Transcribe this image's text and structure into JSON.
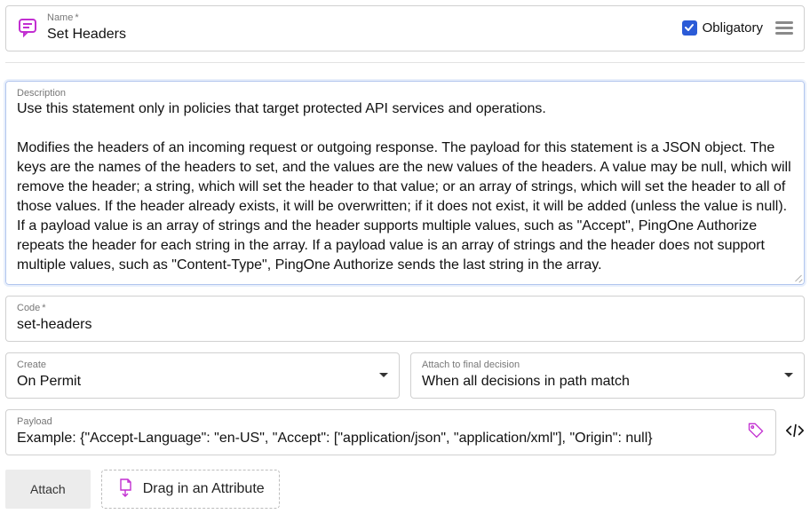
{
  "name": {
    "label": "Name",
    "required_marker": "*",
    "value": "Set Headers"
  },
  "obligatory": {
    "label": "Obligatory",
    "checked": true
  },
  "description": {
    "label": "Description",
    "value": "Use this statement only in policies that target protected API services and operations.\n\nModifies the headers of an incoming request or outgoing response. The payload for this statement is a JSON object. The keys are the names of the headers to set, and the values are the new values of the headers. A value may be null, which will remove the header; a string, which will set the header to that value; or an array of strings, which will set the header to all of those values. If the header already exists, it will be overwritten; if it does not exist, it will be added (unless the value is null). If a payload value is an array of strings and the header supports multiple values, such as \"Accept\", PingOne Authorize repeats the header for each string in the array. If a payload value is an array of strings and the header does not support multiple values, such as \"Content-Type\", PingOne Authorize sends the last string in the array."
  },
  "code": {
    "label": "Code",
    "required_marker": "*",
    "value": "set-headers"
  },
  "create": {
    "label": "Create",
    "value": "On Permit"
  },
  "attach_to": {
    "label": "Attach to final decision",
    "value": "When all decisions in path match"
  },
  "payload": {
    "label": "Payload",
    "value": "Example: {\"Accept-Language\": \"en-US\", \"Accept\": [\"application/json\", \"application/xml\"], \"Origin\": null}"
  },
  "buttons": {
    "attach": "Attach",
    "drag_hint": "Drag in an Attribute"
  }
}
